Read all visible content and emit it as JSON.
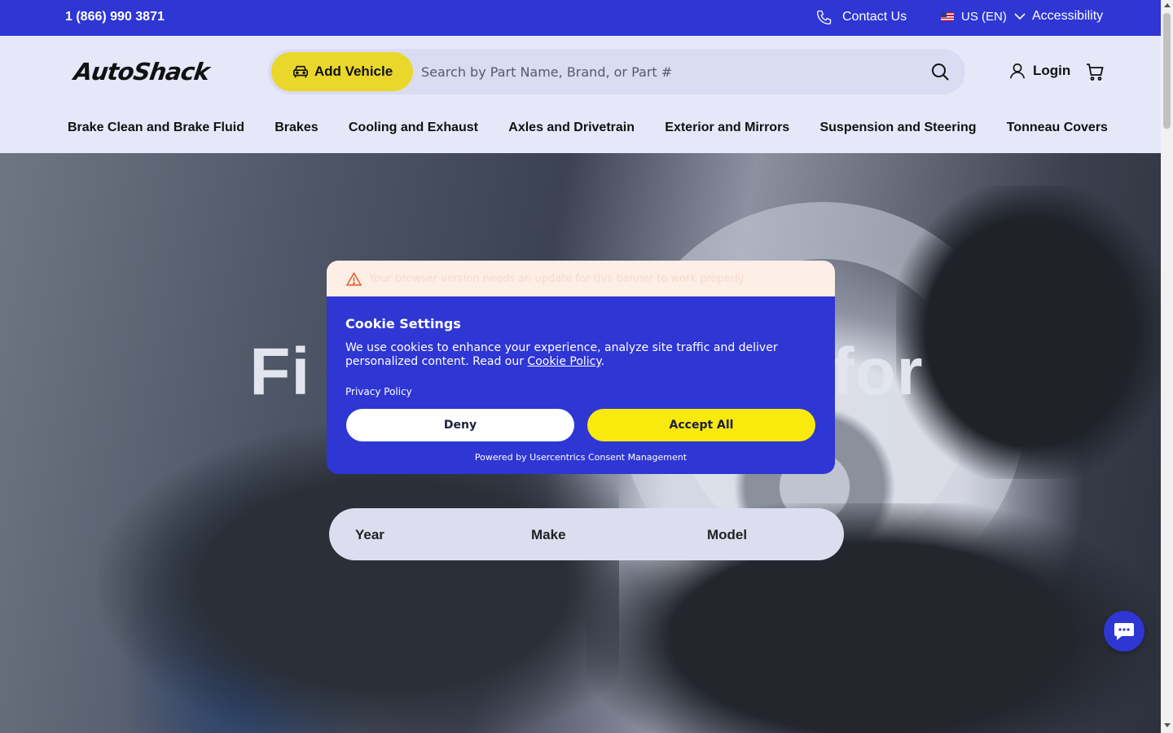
{
  "topbar": {
    "phone": "1 (866) 990 3871",
    "contact_label": "Contact Us",
    "language": "US (EN)",
    "accessibility_label": "Accessibility"
  },
  "header": {
    "logo": "AutoShack",
    "add_vehicle_label": "Add Vehicle",
    "search_placeholder": "Search by Part Name, Brand, or Part #",
    "login_label": "Login"
  },
  "nav": {
    "items": [
      {
        "label": "Brake Clean and Brake Fluid"
      },
      {
        "label": "Brakes"
      },
      {
        "label": "Cooling and Exhaust"
      },
      {
        "label": "Axles and Drivetrain"
      },
      {
        "label": "Exterior and Mirrors"
      },
      {
        "label": "Suspension and Steering"
      },
      {
        "label": "Tonneau Covers"
      }
    ]
  },
  "hero": {
    "title_left": "Fi",
    "title_right": "for",
    "vehicle_selector": {
      "year_label": "Year",
      "make_label": "Make",
      "model_label": "Model"
    }
  },
  "cookie_dialog": {
    "warning": "Your browser version needs an update for this banner to work properly.",
    "title": "Cookie Settings",
    "description": "We use cookies to enhance your experience, analyze site traffic and deliver personalized content. Read our ",
    "policy_link": "Cookie Policy",
    "description_end": ".",
    "privacy_link": "Privacy Policy",
    "deny_label": "Deny",
    "accept_label": "Accept All",
    "powered_by": "Powered by Usercentrics Consent Management"
  },
  "colors": {
    "brand_blue": "#2e36d4",
    "brand_yellow": "#e9d72c",
    "accept_yellow": "#f9e90d",
    "header_bg": "#e6e8fa"
  },
  "icons": {
    "contact": "phone-icon",
    "language": "us-flag-icon",
    "accessibility": "chevron-down-icon",
    "add_vehicle": "car-icon",
    "search": "search-icon",
    "login": "user-icon",
    "cart": "cart-icon",
    "warning": "warning-icon",
    "chat": "chat-icon"
  }
}
